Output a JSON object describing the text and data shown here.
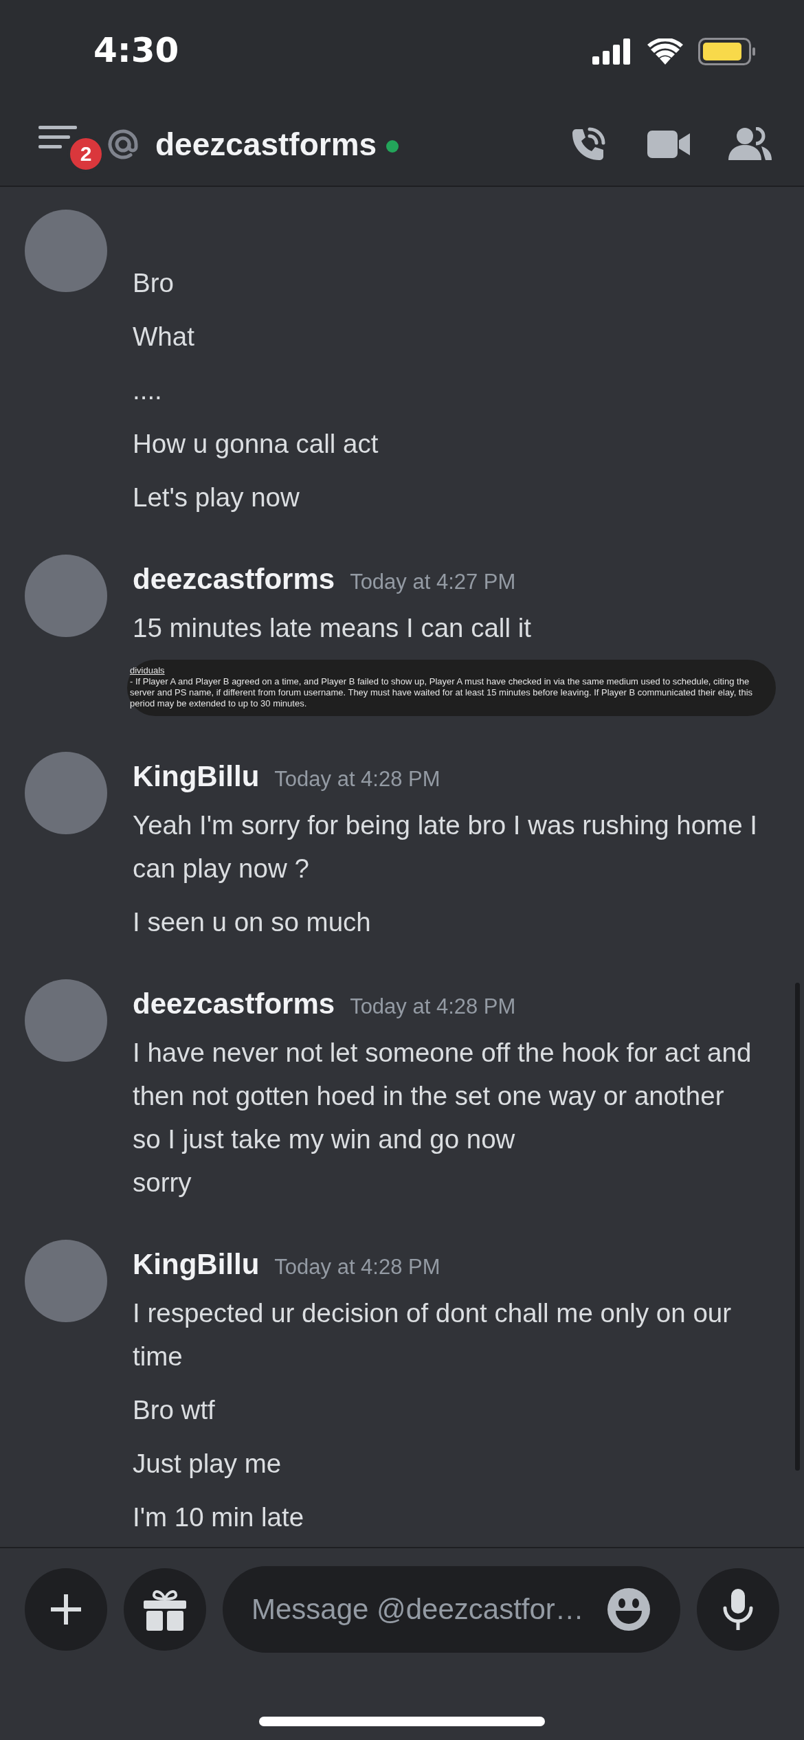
{
  "status_bar": {
    "time": "4:30"
  },
  "header": {
    "badge": "2",
    "title": "deezcastforms",
    "online": true
  },
  "groups": [
    {
      "messages": [
        "Bro",
        "What",
        "....",
        "How u gonna call act",
        "Let's play now"
      ]
    },
    {
      "author": "deezcastforms",
      "time": "Today at 4:27 PM",
      "messages": [
        "15 minutes late means I can call it"
      ],
      "attachment": {
        "heading": "dividuals",
        "body": "- If Player A and Player B agreed on a time, and Player B failed to show up, Player A must have checked in via the same medium used to schedule, citing the server and PS name, if different from forum username. They must have waited for at least 15 minutes before leaving. If Player B communicated their elay, this period may be extended to up to 30 minutes."
      }
    },
    {
      "author": "KingBillu",
      "time": "Today at 4:28 PM",
      "messages": [
        "Yeah I'm sorry for being late bro I was rushing home I can play now ?",
        "I seen u on so much"
      ]
    },
    {
      "author": "deezcastforms",
      "time": "Today at 4:28 PM",
      "messages": [
        "I have never not let someone off the hook for act and then not gotten hoed in the set one way or another\nso I just take my win and go now\nsorry"
      ]
    },
    {
      "author": "KingBillu",
      "time": "Today at 4:28 PM",
      "messages": [
        "I respected ur decision of dont chall me only on our time",
        "Bro wtf",
        "Just play me",
        "I'm 10 min late"
      ]
    }
  ],
  "composer": {
    "placeholder": "Message @deezcastfor…"
  }
}
